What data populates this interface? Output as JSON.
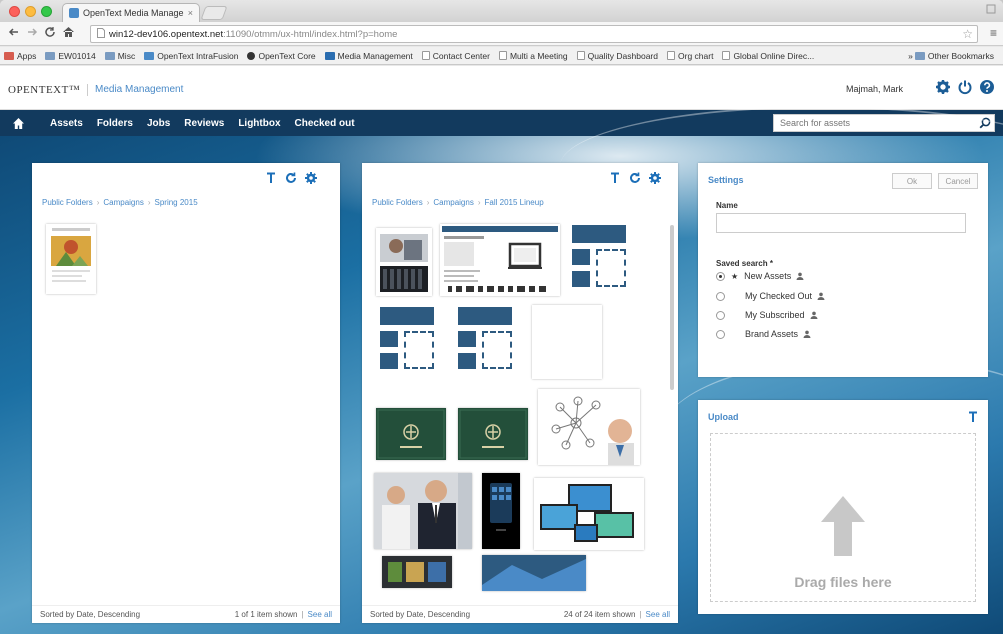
{
  "browser": {
    "tab_title": "OpenText Media Manage",
    "tab_close": "×",
    "url_host": "win12-dev106.opentext.net",
    "url_path": ":11090/otmm/ux-html/index.html?p=home",
    "bookmarks": [
      "Apps",
      "EW01014",
      "Misc",
      "OpenText IntraFusion",
      "OpenText Core",
      "Media Management",
      "Contact Center",
      "Multi a Meeting",
      "Quality Dashboard",
      "Org chart",
      "Global Online Direc..."
    ],
    "bookmarks_more": "»",
    "other_bookmarks": "Other Bookmarks"
  },
  "header": {
    "logo": "OPENTEXT™",
    "app_title": "Media Management",
    "user": "Majmah, Mark"
  },
  "nav": {
    "items": [
      "Assets",
      "Folders",
      "Jobs",
      "Reviews",
      "Lightbox",
      "Checked out"
    ],
    "search_placeholder": "Search for assets"
  },
  "left_panel": {
    "breadcrumb": [
      "Public Folders",
      "Campaigns",
      "Spring 2015"
    ],
    "footer_sort": "Sorted by Date, Descending",
    "footer_count": "1 of 1 item shown",
    "footer_bar": "|",
    "footer_seeall": "See all"
  },
  "middle_panel": {
    "breadcrumb": [
      "Public Folders",
      "Campaigns",
      "Fall 2015 Lineup"
    ],
    "footer_sort": "Sorted by Date, Descending",
    "footer_count": "24 of 24 item shown",
    "footer_bar": "|",
    "footer_seeall": "See all"
  },
  "settings": {
    "title": "Settings",
    "ok": "Ok",
    "cancel": "Cancel",
    "name_label": "Name",
    "saved_search_label": "Saved search *",
    "searches": [
      {
        "label": "New Assets",
        "selected": true
      },
      {
        "label": "My Checked Out",
        "selected": false
      },
      {
        "label": "My Subscribed",
        "selected": false
      },
      {
        "label": "Brand Assets",
        "selected": false
      }
    ]
  },
  "upload": {
    "title": "Upload",
    "drop_text": "Drag files here"
  },
  "colors": {
    "nav_bg": "#123a5e",
    "link": "#4a8ac7",
    "tile_blue": "#2d5a80"
  }
}
